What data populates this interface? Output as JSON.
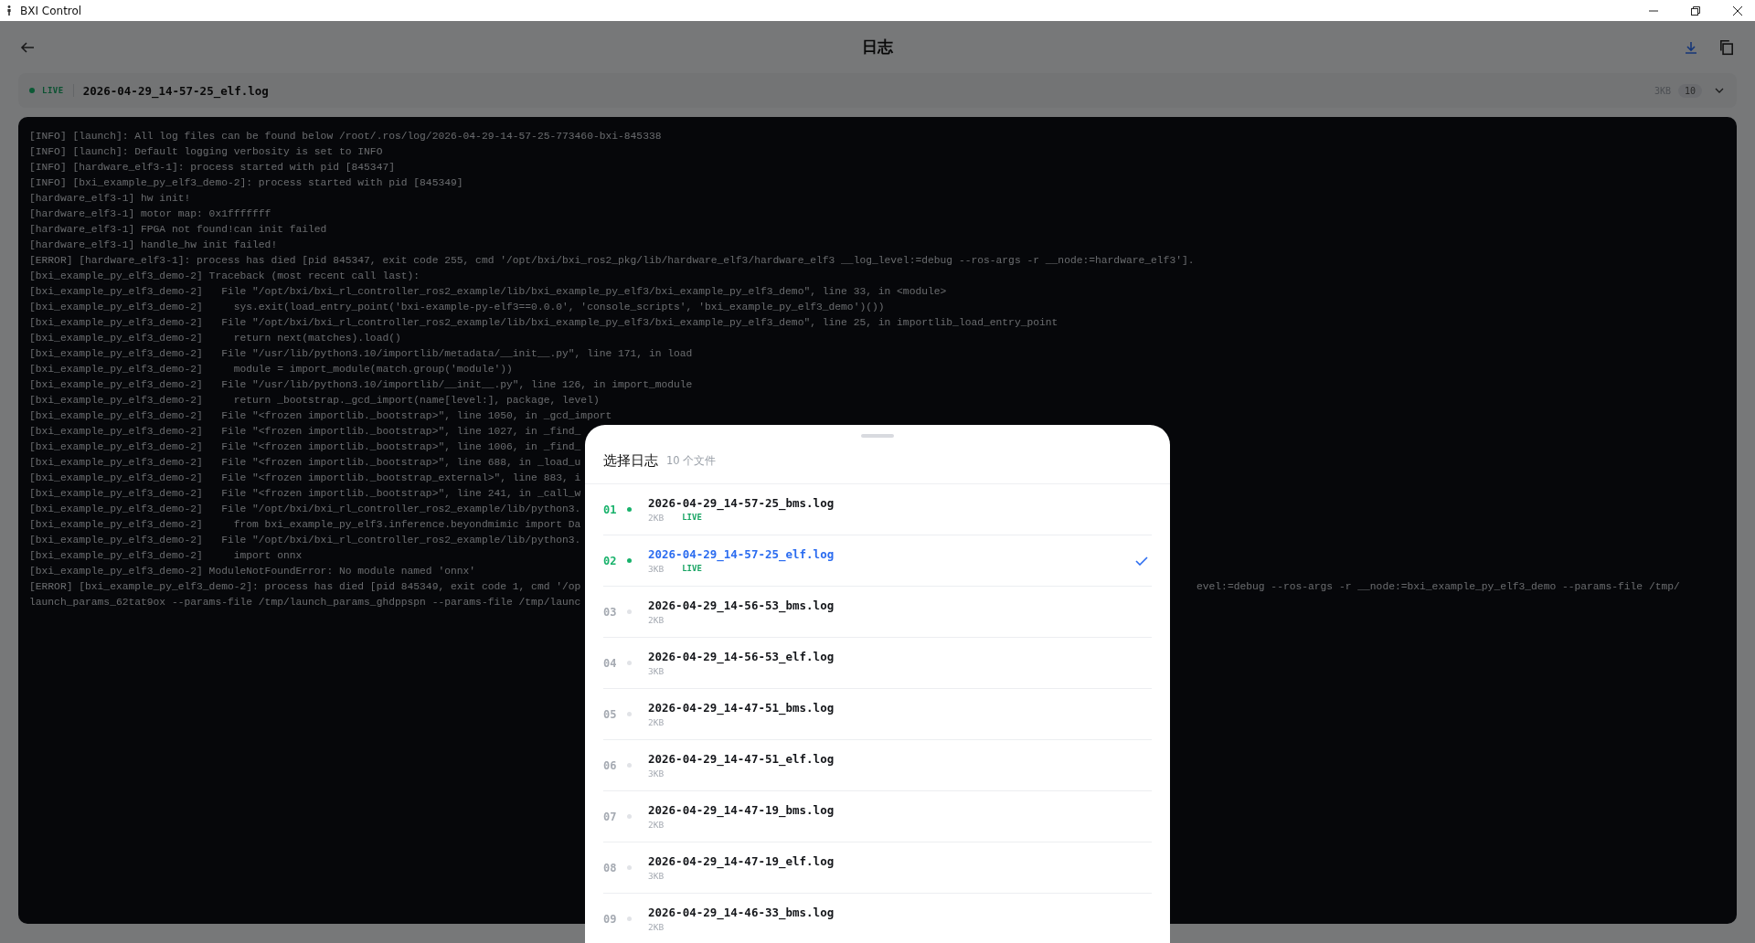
{
  "window": {
    "title": "BXI Control"
  },
  "header": {
    "title": "日志"
  },
  "current_file": {
    "live": true,
    "status": "LIVE",
    "name": "2026-04-29_14-57-25_elf.log",
    "size": "3KB",
    "count": "10"
  },
  "log_lines": [
    {
      "text": "[INFO] [launch]: All log files can be found below /root/.ros/log/2026-04-29-14-57-25-773460-bxi-845338"
    },
    {
      "text": "[INFO] [launch]: Default logging verbosity is set to INFO"
    },
    {
      "text": "[INFO] [hardware_elf3-1]: process started with pid [845347]"
    },
    {
      "text": "[INFO] [bxi_example_py_elf3_demo-2]: process started with pid [845349]"
    },
    {
      "text": "[hardware_elf3-1] hw init!"
    },
    {
      "text": "[hardware_elf3-1] motor map: 0x1fffffff"
    },
    {
      "text": "[hardware_elf3-1] FPGA not found!can init failed"
    },
    {
      "text": "[hardware_elf3-1] handle_hw init failed!"
    },
    {
      "text": "[ERROR] [hardware_elf3-1]: process has died [pid 845347, exit code 255, cmd '/opt/bxi/bxi_ros2_pkg/lib/hardware_elf3/hardware_elf3 __log_level:=debug --ros-args -r __node:=hardware_elf3']."
    },
    {
      "text": "[bxi_example_py_elf3_demo-2] Traceback (most recent call last):"
    },
    {
      "text": "[bxi_example_py_elf3_demo-2]   File \"/opt/bxi/bxi_rl_controller_ros2_example/lib/bxi_example_py_elf3/bxi_example_py_elf3_demo\", line 33, in <module>"
    },
    {
      "text": "[bxi_example_py_elf3_demo-2]     sys.exit(load_entry_point('bxi-example-py-elf3==0.0.0', 'console_scripts', 'bxi_example_py_elf3_demo')())"
    },
    {
      "text": "[bxi_example_py_elf3_demo-2]   File \"/opt/bxi/bxi_rl_controller_ros2_example/lib/bxi_example_py_elf3/bxi_example_py_elf3_demo\", line 25, in importlib_load_entry_point"
    },
    {
      "text": "[bxi_example_py_elf3_demo-2]     return next(matches).load()"
    },
    {
      "text": "[bxi_example_py_elf3_demo-2]   File \"/usr/lib/python3.10/importlib/metadata/__init__.py\", line 171, in load"
    },
    {
      "text": "[bxi_example_py_elf3_demo-2]     module = import_module(match.group('module'))"
    },
    {
      "text": "[bxi_example_py_elf3_demo-2]   File \"/usr/lib/python3.10/importlib/__init__.py\", line 126, in import_module"
    },
    {
      "text": "[bxi_example_py_elf3_demo-2]     return _bootstrap._gcd_import(name[level:], package, level)"
    },
    {
      "text": "[bxi_example_py_elf3_demo-2]   File \"<frozen importlib._bootstrap>\", line 1050, in _gcd_import"
    },
    {
      "text": "[bxi_example_py_elf3_demo-2]   File \"<frozen importlib._bootstrap>\", line 1027, in _find_"
    },
    {
      "text": "[bxi_example_py_elf3_demo-2]   File \"<frozen importlib._bootstrap>\", line 1006, in _find_"
    },
    {
      "text": "[bxi_example_py_elf3_demo-2]   File \"<frozen importlib._bootstrap>\", line 688, in _load_u"
    },
    {
      "text": "[bxi_example_py_elf3_demo-2]   File \"<frozen importlib._bootstrap_external>\", line 883, i"
    },
    {
      "text": "[bxi_example_py_elf3_demo-2]   File \"<frozen importlib._bootstrap>\", line 241, in _call_w"
    },
    {
      "text": "[bxi_example_py_elf3_demo-2]   File \"/opt/bxi/bxi_rl_controller_ros2_example/lib/python3."
    },
    {
      "text": "[bxi_example_py_elf3_demo-2]     from bxi_example_py_elf3.inference.beyondmimic import Da"
    },
    {
      "text": "[bxi_example_py_elf3_demo-2]   File \"/opt/bxi/bxi_rl_controller_ros2_example/lib/python3."
    },
    {
      "text": "[bxi_example_py_elf3_demo-2]     import onnx"
    },
    {
      "text": "[bxi_example_py_elf3_demo-2] ModuleNotFoundError: No module named 'onnx'"
    },
    {
      "text": "[ERROR] [bxi_example_py_elf3_demo-2]: process has died [pid 845349, exit code 1, cmd '/op",
      "right": "evel:=debug --ros-args -r __node:=bxi_example_py_elf3_demo --params-file /tmp/"
    },
    {
      "text": "launch_params_62tat9ox --params-file /tmp/launch_params_ghdppspn --params-file /tmp/launc"
    }
  ],
  "picker": {
    "title": "选择日志",
    "subtitle": "10 个文件",
    "files": [
      {
        "index": "01",
        "name": "2026-04-29_14-57-25_bms.log",
        "size": "2KB",
        "live": true,
        "live_label": "LIVE",
        "selected": false
      },
      {
        "index": "02",
        "name": "2026-04-29_14-57-25_elf.log",
        "size": "3KB",
        "live": true,
        "live_label": "LIVE",
        "selected": true
      },
      {
        "index": "03",
        "name": "2026-04-29_14-56-53_bms.log",
        "size": "2KB",
        "live": false,
        "selected": false
      },
      {
        "index": "04",
        "name": "2026-04-29_14-56-53_elf.log",
        "size": "3KB",
        "live": false,
        "selected": false
      },
      {
        "index": "05",
        "name": "2026-04-29_14-47-51_bms.log",
        "size": "2KB",
        "live": false,
        "selected": false
      },
      {
        "index": "06",
        "name": "2026-04-29_14-47-51_elf.log",
        "size": "3KB",
        "live": false,
        "selected": false
      },
      {
        "index": "07",
        "name": "2026-04-29_14-47-19_bms.log",
        "size": "2KB",
        "live": false,
        "selected": false
      },
      {
        "index": "08",
        "name": "2026-04-29_14-47-19_elf.log",
        "size": "3KB",
        "live": false,
        "selected": false
      },
      {
        "index": "09",
        "name": "2026-04-29_14-46-33_bms.log",
        "size": "2KB",
        "live": false,
        "selected": false
      }
    ]
  }
}
